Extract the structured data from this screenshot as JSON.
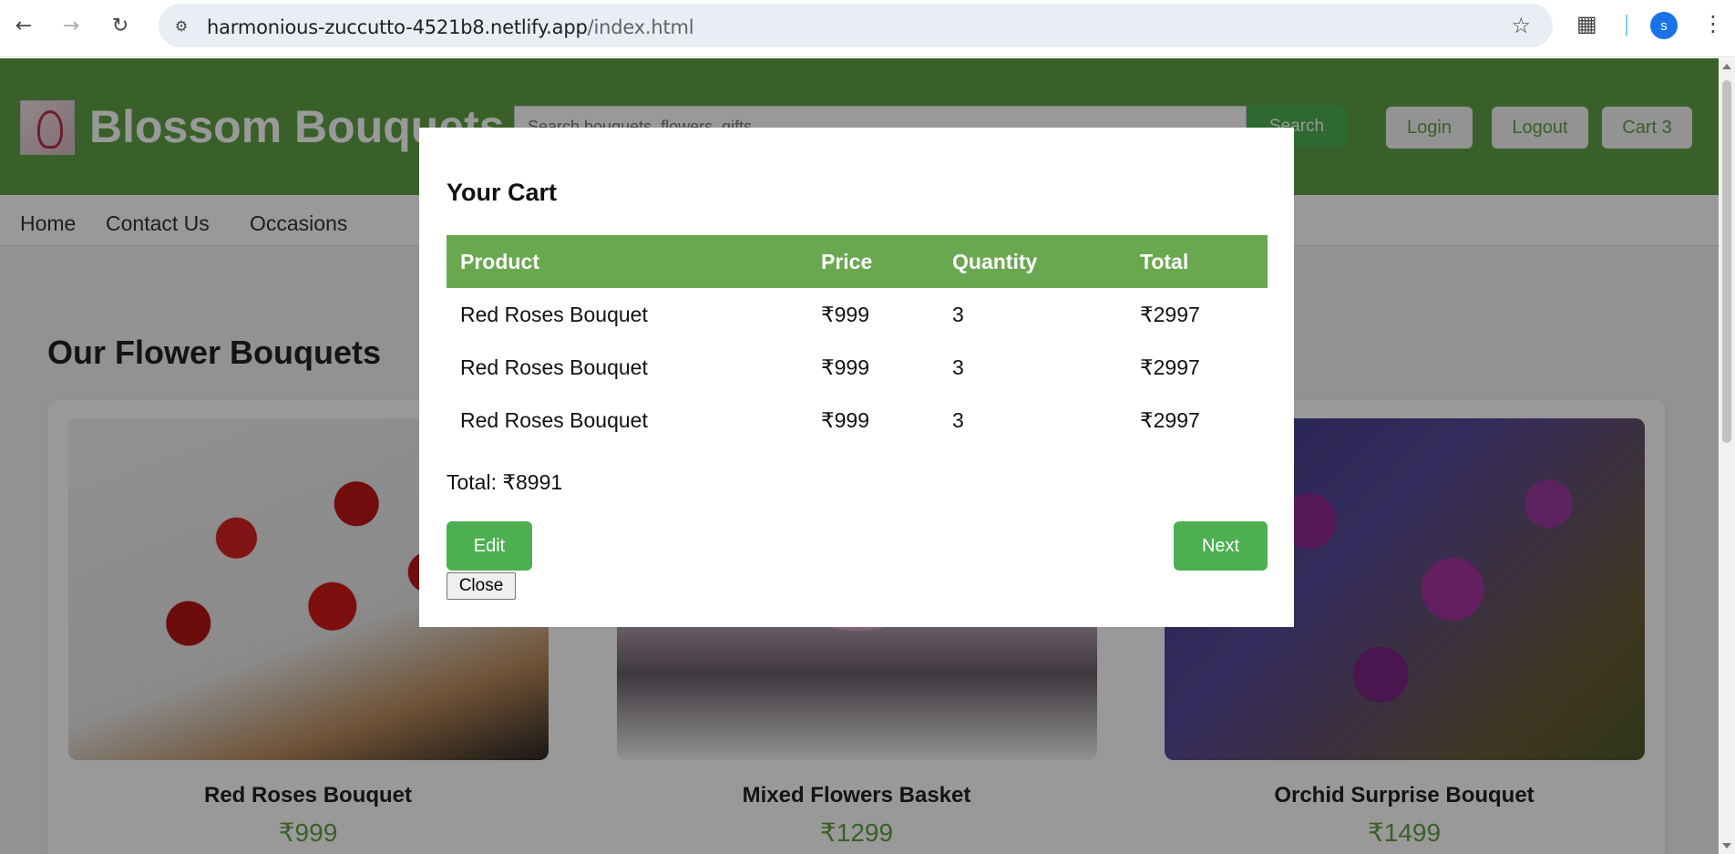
{
  "browser": {
    "url_host": "harmonious-zuccutto-4521b8.netlify.app",
    "url_path": "/index.html",
    "profile_initial": "s",
    "icons": [
      "back-arrow-icon",
      "forward-arrow-icon",
      "reload-icon",
      "site-info-icon",
      "star-icon",
      "extensions-icon",
      "kebab-menu-icon"
    ]
  },
  "header": {
    "title": "Blossom Bouquets",
    "search_placeholder": "Search bouquets, flowers, gifts...",
    "search_label": "Search",
    "login_label": "Login",
    "logout_label": "Logout",
    "cart_label": "Cart 3",
    "brand_color": "#5fa045"
  },
  "nav": {
    "items": [
      {
        "label": "Home"
      },
      {
        "label": "Contact Us"
      },
      {
        "label": "Occasions"
      }
    ]
  },
  "main": {
    "section_title": "Our Flower Bouquets",
    "products": [
      {
        "name": "Red Roses Bouquet",
        "price": "₹999"
      },
      {
        "name": "Mixed Flowers Basket",
        "price": "₹1299"
      },
      {
        "name": "Orchid Surprise Bouquet",
        "price": "₹1499"
      }
    ]
  },
  "modal": {
    "title": "Your Cart",
    "columns": [
      "Product",
      "Price",
      "Quantity",
      "Total"
    ],
    "rows": [
      {
        "product": "Red Roses Bouquet",
        "price": "₹999",
        "quantity": "3",
        "total": "₹2997"
      },
      {
        "product": "Red Roses Bouquet",
        "price": "₹999",
        "quantity": "3",
        "total": "₹2997"
      },
      {
        "product": "Red Roses Bouquet",
        "price": "₹999",
        "quantity": "3",
        "total": "₹2997"
      }
    ],
    "total_text": "Total: ₹8991",
    "edit_label": "Edit",
    "next_label": "Next",
    "close_label": "Close",
    "header_color": "#6aa84f",
    "button_color": "#4caf50"
  }
}
